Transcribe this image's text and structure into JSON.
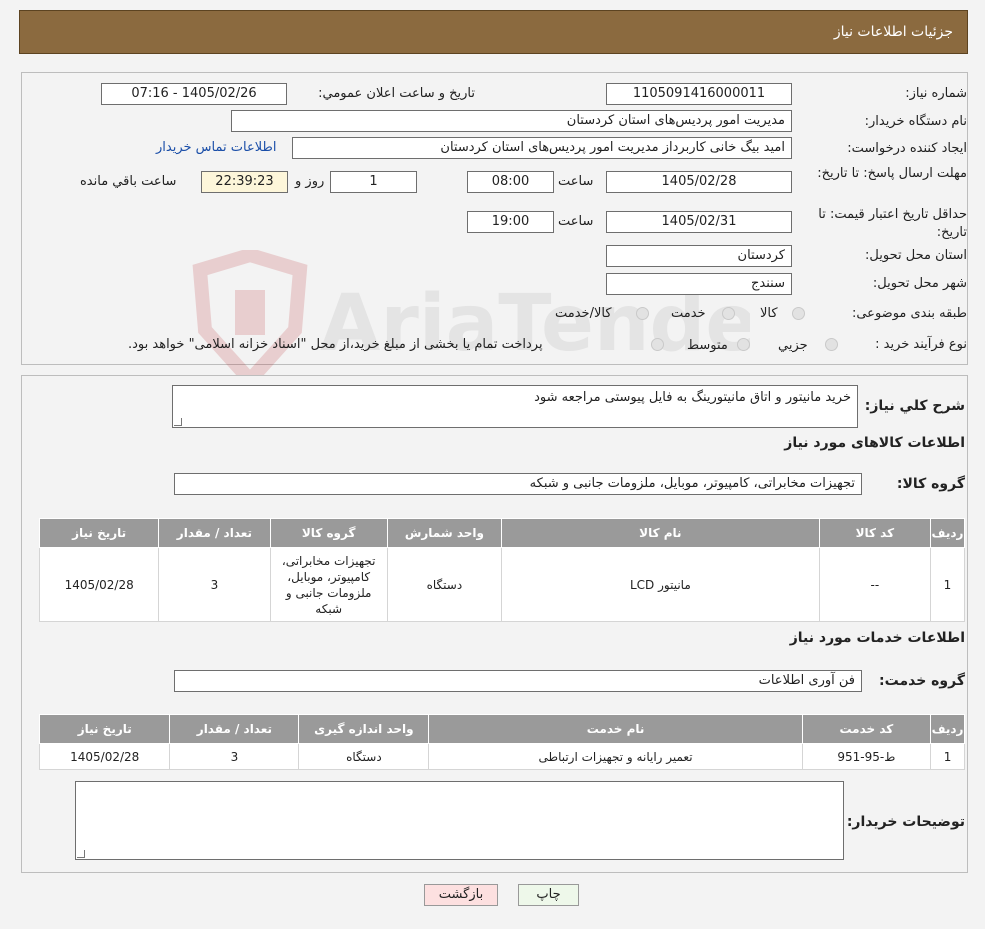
{
  "header": {
    "title": "جزئیات اطلاعات نیاز"
  },
  "watermark": {
    "text": "AriaTender.neT"
  },
  "form": {
    "need_number": {
      "label": "شماره نیاز:",
      "value": "1105091416000011"
    },
    "announce_date": {
      "label": "تاريخ و ساعت اعلان عمومي:",
      "value": "1405/02/26 - 07:16"
    },
    "buyer_org": {
      "label": "نام دستگاه خريدار:",
      "value": "مدیریت امور پردیس‌های استان کردستان"
    },
    "requester": {
      "label": "ايجاد کننده درخواست:",
      "value": "امید بیگ خانی کاربرداز مدیریت امور پردیس‌های استان کردستان",
      "contact_link": "اطلاعات تماس خریدار"
    },
    "reply_deadline": {
      "label": "مهلت ارسال پاسخ: تا تاريخ:",
      "date": "1405/02/28",
      "time_label": "ساعت",
      "time": "08:00",
      "days": "1",
      "days_label": "روز و",
      "remaining": "22:39:23",
      "remaining_label": "ساعت باقي مانده"
    },
    "price_validity": {
      "label": "حداقل تاريخ اعتبار قيمت: تا تاريخ:",
      "date": "1405/02/31",
      "time_label": "ساعت",
      "time": "19:00"
    },
    "province": {
      "label": "استان محل تحويل:",
      "value": "کردستان"
    },
    "city": {
      "label": "شهر محل تحويل:",
      "value": "سنندج"
    },
    "category": {
      "label": "طبقه بندی موضوعی:",
      "options": [
        "کالا",
        "خدمت",
        "کالا/خدمت"
      ]
    },
    "process": {
      "label": "نوع فرآيند خريد :",
      "options": [
        "جزیي",
        "متوسط"
      ],
      "note": "پرداخت تمام یا بخشی از مبلغ خرید،از محل \"اسناد خزانه اسلامی\" خواهد بود."
    }
  },
  "description": {
    "label": "شرح کلي نياز:",
    "value": "خرید مانیتور و اتاق مانیتورینگ به فایل پیوستی مراجعه شود"
  },
  "goods": {
    "section_title": "اطلاعات کالاهای مورد نياز",
    "group_label": "گروه کالا:",
    "group_value": "تجهیزات مخابراتی، کامپیوتر، موبایل، ملزومات جانبی و شبکه",
    "headers": [
      "رديف",
      "کد کالا",
      "نام کالا",
      "واحد شمارش",
      "گروه کالا",
      "تعداد / مقدار",
      "تاريخ نياز"
    ],
    "rows": [
      {
        "index": "1",
        "code": "--",
        "name": "مانیتور LCD",
        "unit": "دستگاه",
        "group": "تجهیزات مخابراتی، کامپیوتر، موبایل، ملزومات جانبی و شبکه",
        "qty": "3",
        "date": "1405/02/28"
      }
    ]
  },
  "services": {
    "section_title": "اطلاعات خدمات مورد نياز",
    "group_label": "گروه خدمت:",
    "group_value": "فن آوری اطلاعات",
    "headers": [
      "رديف",
      "کد خدمت",
      "نام خدمت",
      "واحد اندازه گيری",
      "تعداد / مقدار",
      "تاريخ نياز"
    ],
    "rows": [
      {
        "index": "1",
        "code": "ط-95-951",
        "name": "تعمیر رایانه و تجهیزات ارتباطی",
        "unit": "دستگاه",
        "qty": "3",
        "date": "1405/02/28"
      }
    ]
  },
  "buyer_notes": {
    "label": "توضيحات خريدار:",
    "value": ""
  },
  "buttons": {
    "print": "چاپ",
    "back": "بازگشت"
  }
}
